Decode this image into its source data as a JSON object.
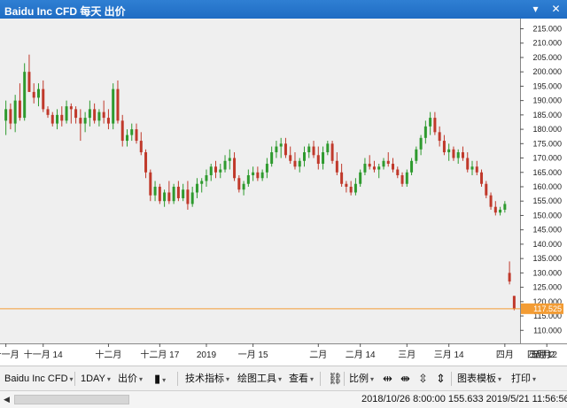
{
  "window": {
    "title": "Baidu Inc CFD 每天 出价",
    "minimize_label": "▾",
    "close_label": "✕"
  },
  "colors": {
    "background": "#efefef",
    "up_candle": "#2e9a2e",
    "down_candle": "#c0392b",
    "price_line": "#f39c34",
    "price_tag_bg": "#f39c34",
    "axis_text": "#222222"
  },
  "chart_data": {
    "type": "candlestick",
    "title": "",
    "ylim": [
      107,
      217
    ],
    "y_ticks": [
      "215.000",
      "210.000",
      "205.000",
      "200.000",
      "195.000",
      "190.000",
      "185.000",
      "180.000",
      "175.000",
      "170.000",
      "165.000",
      "160.000",
      "155.000",
      "150.000",
      "145.000",
      "140.000",
      "135.000",
      "130.000",
      "125.000",
      "120.000",
      "115.000",
      "110.000"
    ],
    "x_ticks": [
      {
        "label": "十一月",
        "index": 0
      },
      {
        "label": "十一月 14",
        "index": 8
      },
      {
        "label": "十二月",
        "index": 22
      },
      {
        "label": "十二月 17",
        "index": 33
      },
      {
        "label": "2019",
        "index": 43
      },
      {
        "label": "一月 15",
        "index": 53
      },
      {
        "label": "二月",
        "index": 67
      },
      {
        "label": "二月 14",
        "index": 76
      },
      {
        "label": "三月",
        "index": 86
      },
      {
        "label": "三月 14",
        "index": 95
      },
      {
        "label": "四月",
        "index": 107
      },
      {
        "label": "四月 12",
        "index": 116
      },
      {
        "label": "五月",
        "index": 128
      },
      {
        "label": "五月 2",
        "index": 141
      }
    ],
    "current_price": 117.525,
    "current_price_label": "117.525",
    "candles": [
      {
        "o": 183,
        "h": 190,
        "l": 178,
        "c": 187
      },
      {
        "o": 187,
        "h": 189,
        "l": 180,
        "c": 182
      },
      {
        "o": 182,
        "h": 192,
        "l": 179,
        "c": 190
      },
      {
        "o": 190,
        "h": 196,
        "l": 183,
        "c": 184
      },
      {
        "o": 184,
        "h": 203,
        "l": 183,
        "c": 200
      },
      {
        "o": 200,
        "h": 206,
        "l": 193,
        "c": 193
      },
      {
        "o": 193,
        "h": 196,
        "l": 189,
        "c": 191
      },
      {
        "o": 191,
        "h": 196,
        "l": 188,
        "c": 194
      },
      {
        "o": 194,
        "h": 197,
        "l": 186,
        "c": 187
      },
      {
        "o": 187,
        "h": 188,
        "l": 184,
        "c": 185
      },
      {
        "o": 185,
        "h": 186,
        "l": 181,
        "c": 182
      },
      {
        "o": 182,
        "h": 187,
        "l": 180,
        "c": 185
      },
      {
        "o": 185,
        "h": 188,
        "l": 181,
        "c": 183
      },
      {
        "o": 183,
        "h": 190,
        "l": 182,
        "c": 188
      },
      {
        "o": 188,
        "h": 189,
        "l": 182,
        "c": 187
      },
      {
        "o": 187,
        "h": 188,
        "l": 182,
        "c": 184
      },
      {
        "o": 184,
        "h": 187,
        "l": 176,
        "c": 182
      },
      {
        "o": 182,
        "h": 186,
        "l": 179,
        "c": 184
      },
      {
        "o": 184,
        "h": 190,
        "l": 181,
        "c": 187
      },
      {
        "o": 187,
        "h": 189,
        "l": 182,
        "c": 183
      },
      {
        "o": 183,
        "h": 187,
        "l": 181,
        "c": 186
      },
      {
        "o": 186,
        "h": 190,
        "l": 182,
        "c": 184
      },
      {
        "o": 184,
        "h": 187,
        "l": 180,
        "c": 182
      },
      {
        "o": 182,
        "h": 196,
        "l": 180,
        "c": 194
      },
      {
        "o": 194,
        "h": 197,
        "l": 182,
        "c": 183
      },
      {
        "o": 183,
        "h": 185,
        "l": 174,
        "c": 176
      },
      {
        "o": 176,
        "h": 180,
        "l": 174,
        "c": 178
      },
      {
        "o": 178,
        "h": 182,
        "l": 176,
        "c": 180
      },
      {
        "o": 180,
        "h": 182,
        "l": 175,
        "c": 176
      },
      {
        "o": 176,
        "h": 179,
        "l": 171,
        "c": 172
      },
      {
        "o": 172,
        "h": 173,
        "l": 163,
        "c": 165
      },
      {
        "o": 165,
        "h": 166,
        "l": 155,
        "c": 157
      },
      {
        "o": 157,
        "h": 162,
        "l": 155,
        "c": 160
      },
      {
        "o": 160,
        "h": 161,
        "l": 154,
        "c": 155
      },
      {
        "o": 155,
        "h": 159,
        "l": 153,
        "c": 158
      },
      {
        "o": 158,
        "h": 162,
        "l": 154,
        "c": 155
      },
      {
        "o": 155,
        "h": 161,
        "l": 154,
        "c": 160
      },
      {
        "o": 160,
        "h": 162,
        "l": 155,
        "c": 156
      },
      {
        "o": 156,
        "h": 161,
        "l": 155,
        "c": 159
      },
      {
        "o": 159,
        "h": 162,
        "l": 152,
        "c": 154
      },
      {
        "o": 154,
        "h": 160,
        "l": 153,
        "c": 158
      },
      {
        "o": 158,
        "h": 163,
        "l": 156,
        "c": 161
      },
      {
        "o": 161,
        "h": 163,
        "l": 158,
        "c": 162
      },
      {
        "o": 162,
        "h": 166,
        "l": 160,
        "c": 164
      },
      {
        "o": 164,
        "h": 168,
        "l": 162,
        "c": 167
      },
      {
        "o": 167,
        "h": 169,
        "l": 163,
        "c": 165
      },
      {
        "o": 165,
        "h": 168,
        "l": 163,
        "c": 166
      },
      {
        "o": 166,
        "h": 171,
        "l": 165,
        "c": 169
      },
      {
        "o": 169,
        "h": 173,
        "l": 166,
        "c": 170
      },
      {
        "o": 170,
        "h": 172,
        "l": 162,
        "c": 163
      },
      {
        "o": 163,
        "h": 164,
        "l": 158,
        "c": 159
      },
      {
        "o": 159,
        "h": 162,
        "l": 157,
        "c": 161
      },
      {
        "o": 161,
        "h": 166,
        "l": 160,
        "c": 164
      },
      {
        "o": 164,
        "h": 167,
        "l": 162,
        "c": 165
      },
      {
        "o": 165,
        "h": 167,
        "l": 162,
        "c": 163
      },
      {
        "o": 163,
        "h": 166,
        "l": 162,
        "c": 165
      },
      {
        "o": 165,
        "h": 170,
        "l": 163,
        "c": 168
      },
      {
        "o": 168,
        "h": 174,
        "l": 167,
        "c": 172
      },
      {
        "o": 172,
        "h": 176,
        "l": 170,
        "c": 174
      },
      {
        "o": 174,
        "h": 177,
        "l": 170,
        "c": 175
      },
      {
        "o": 175,
        "h": 177,
        "l": 170,
        "c": 171
      },
      {
        "o": 171,
        "h": 174,
        "l": 168,
        "c": 169
      },
      {
        "o": 169,
        "h": 172,
        "l": 166,
        "c": 167
      },
      {
        "o": 167,
        "h": 170,
        "l": 165,
        "c": 169
      },
      {
        "o": 169,
        "h": 174,
        "l": 167,
        "c": 172
      },
      {
        "o": 172,
        "h": 175,
        "l": 170,
        "c": 174
      },
      {
        "o": 174,
        "h": 176,
        "l": 170,
        "c": 171
      },
      {
        "o": 171,
        "h": 174,
        "l": 166,
        "c": 168
      },
      {
        "o": 168,
        "h": 174,
        "l": 166,
        "c": 172
      },
      {
        "o": 172,
        "h": 176,
        "l": 171,
        "c": 175
      },
      {
        "o": 175,
        "h": 176,
        "l": 168,
        "c": 169
      },
      {
        "o": 169,
        "h": 172,
        "l": 164,
        "c": 165
      },
      {
        "o": 165,
        "h": 168,
        "l": 160,
        "c": 161
      },
      {
        "o": 161,
        "h": 162,
        "l": 158,
        "c": 160
      },
      {
        "o": 160,
        "h": 162,
        "l": 157,
        "c": 158
      },
      {
        "o": 158,
        "h": 163,
        "l": 157,
        "c": 161
      },
      {
        "o": 161,
        "h": 166,
        "l": 160,
        "c": 165
      },
      {
        "o": 165,
        "h": 170,
        "l": 164,
        "c": 168
      },
      {
        "o": 168,
        "h": 171,
        "l": 166,
        "c": 167
      },
      {
        "o": 167,
        "h": 169,
        "l": 165,
        "c": 166
      },
      {
        "o": 166,
        "h": 168,
        "l": 163,
        "c": 167
      },
      {
        "o": 167,
        "h": 170,
        "l": 166,
        "c": 169
      },
      {
        "o": 169,
        "h": 172,
        "l": 167,
        "c": 168
      },
      {
        "o": 168,
        "h": 170,
        "l": 165,
        "c": 166
      },
      {
        "o": 166,
        "h": 167,
        "l": 163,
        "c": 164
      },
      {
        "o": 164,
        "h": 165,
        "l": 160,
        "c": 161
      },
      {
        "o": 161,
        "h": 166,
        "l": 160,
        "c": 165
      },
      {
        "o": 165,
        "h": 170,
        "l": 164,
        "c": 169
      },
      {
        "o": 169,
        "h": 174,
        "l": 168,
        "c": 173
      },
      {
        "o": 173,
        "h": 178,
        "l": 171,
        "c": 177
      },
      {
        "o": 177,
        "h": 183,
        "l": 175,
        "c": 181
      },
      {
        "o": 181,
        "h": 186,
        "l": 178,
        "c": 184
      },
      {
        "o": 184,
        "h": 186,
        "l": 178,
        "c": 179
      },
      {
        "o": 179,
        "h": 181,
        "l": 174,
        "c": 176
      },
      {
        "o": 176,
        "h": 178,
        "l": 171,
        "c": 172
      },
      {
        "o": 172,
        "h": 175,
        "l": 169,
        "c": 173
      },
      {
        "o": 173,
        "h": 174,
        "l": 169,
        "c": 170
      },
      {
        "o": 170,
        "h": 173,
        "l": 168,
        "c": 172
      },
      {
        "o": 172,
        "h": 174,
        "l": 169,
        "c": 170
      },
      {
        "o": 170,
        "h": 172,
        "l": 165,
        "c": 166
      },
      {
        "o": 166,
        "h": 169,
        "l": 164,
        "c": 167
      },
      {
        "o": 167,
        "h": 169,
        "l": 164,
        "c": 165
      },
      {
        "o": 165,
        "h": 166,
        "l": 160,
        "c": 161
      },
      {
        "o": 161,
        "h": 162,
        "l": 156,
        "c": 157
      },
      {
        "o": 157,
        "h": 158,
        "l": 152,
        "c": 153
      },
      {
        "o": 153,
        "h": 155,
        "l": 150,
        "c": 151
      },
      {
        "o": 151,
        "h": 153,
        "l": 150,
        "c": 152
      },
      {
        "o": 152,
        "h": 155,
        "l": 151,
        "c": 154
      },
      {
        "o": 130,
        "h": 134,
        "l": 126,
        "c": 127
      },
      {
        "o": 122,
        "h": 122,
        "l": 117,
        "c": 117.5
      }
    ]
  },
  "toolbar": {
    "symbol": "Baidu Inc CFD",
    "interval": "1DAY",
    "price_type": "出价",
    "candle_type_icon": "candle-icon",
    "indicators": "技术指标",
    "drawing_tools": "绘图工具",
    "view": "查看",
    "link_icon": "link-icon",
    "scale": "比例",
    "chart_template": "图表模板",
    "print": "打印"
  },
  "status": {
    "left_arrow": "◀",
    "info": "2018/10/26 8:00:00  155.633   2019/5/21 11:56:56"
  }
}
